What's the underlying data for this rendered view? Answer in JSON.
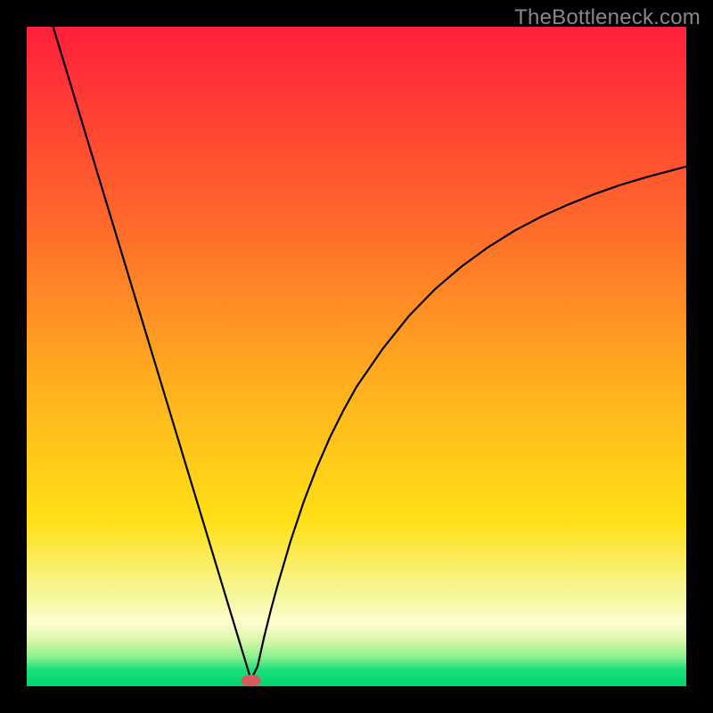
{
  "watermark": "TheBottleneck.com",
  "colors": {
    "frame": "#000000",
    "curve": "#000000",
    "marker": "#d85a5a",
    "gradient_stops": [
      {
        "offset": 0.0,
        "color": "#ff1f3a"
      },
      {
        "offset": 0.3,
        "color": "#ff6a2b"
      },
      {
        "offset": 0.55,
        "color": "#ffb21f"
      },
      {
        "offset": 0.75,
        "color": "#ffe016"
      },
      {
        "offset": 0.86,
        "color": "#f7f79a"
      },
      {
        "offset": 0.905,
        "color": "#fdfdd0"
      },
      {
        "offset": 0.93,
        "color": "#d9f7a8"
      },
      {
        "offset": 0.955,
        "color": "#8ff08f"
      },
      {
        "offset": 0.975,
        "color": "#1ce07a"
      },
      {
        "offset": 1.0,
        "color": "#00d56b"
      }
    ]
  },
  "chart_data": {
    "type": "line",
    "title": "",
    "xlabel": "",
    "ylabel": "",
    "xlim": [
      0,
      100
    ],
    "ylim": [
      0,
      100
    ],
    "grid": false,
    "legend": false,
    "minimum_marker": {
      "x": 34,
      "y": 0
    },
    "series": [
      {
        "name": "bottleneck-curve",
        "x": [
          4,
          6,
          8,
          10,
          12,
          14,
          16,
          18,
          20,
          22,
          24,
          26,
          28,
          30,
          31,
          32,
          33,
          34,
          35,
          36,
          37,
          38,
          40,
          42,
          44,
          46,
          48,
          50,
          54,
          58,
          62,
          66,
          70,
          74,
          78,
          82,
          86,
          90,
          94,
          100
        ],
        "y": [
          100,
          93.4,
          86.8,
          80.2,
          73.6,
          67,
          60.4,
          53.8,
          47.2,
          40.6,
          34,
          27.4,
          20.8,
          14.2,
          10.9,
          7.6,
          4.3,
          1.0,
          3.0,
          7.5,
          11.5,
          15.2,
          22,
          28,
          33.2,
          37.8,
          41.8,
          45.4,
          51.2,
          56.2,
          60.3,
          63.7,
          66.6,
          69.1,
          71.2,
          73.0,
          74.6,
          76.0,
          77.2,
          78.8
        ]
      }
    ]
  }
}
